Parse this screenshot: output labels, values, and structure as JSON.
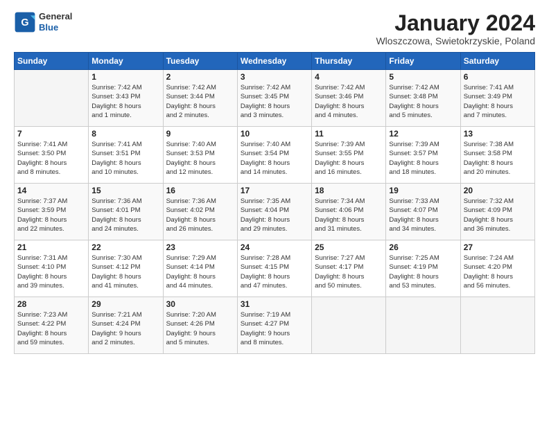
{
  "logo": {
    "line1": "General",
    "line2": "Blue"
  },
  "title": "January 2024",
  "subtitle": "Wloszczowa, Swietokrzyskie, Poland",
  "days_of_week": [
    "Sunday",
    "Monday",
    "Tuesday",
    "Wednesday",
    "Thursday",
    "Friday",
    "Saturday"
  ],
  "weeks": [
    [
      {
        "day": "",
        "info": ""
      },
      {
        "day": "1",
        "info": "Sunrise: 7:42 AM\nSunset: 3:43 PM\nDaylight: 8 hours\nand 1 minute."
      },
      {
        "day": "2",
        "info": "Sunrise: 7:42 AM\nSunset: 3:44 PM\nDaylight: 8 hours\nand 2 minutes."
      },
      {
        "day": "3",
        "info": "Sunrise: 7:42 AM\nSunset: 3:45 PM\nDaylight: 8 hours\nand 3 minutes."
      },
      {
        "day": "4",
        "info": "Sunrise: 7:42 AM\nSunset: 3:46 PM\nDaylight: 8 hours\nand 4 minutes."
      },
      {
        "day": "5",
        "info": "Sunrise: 7:42 AM\nSunset: 3:48 PM\nDaylight: 8 hours\nand 5 minutes."
      },
      {
        "day": "6",
        "info": "Sunrise: 7:41 AM\nSunset: 3:49 PM\nDaylight: 8 hours\nand 7 minutes."
      }
    ],
    [
      {
        "day": "7",
        "info": "Sunrise: 7:41 AM\nSunset: 3:50 PM\nDaylight: 8 hours\nand 8 minutes."
      },
      {
        "day": "8",
        "info": "Sunrise: 7:41 AM\nSunset: 3:51 PM\nDaylight: 8 hours\nand 10 minutes."
      },
      {
        "day": "9",
        "info": "Sunrise: 7:40 AM\nSunset: 3:53 PM\nDaylight: 8 hours\nand 12 minutes."
      },
      {
        "day": "10",
        "info": "Sunrise: 7:40 AM\nSunset: 3:54 PM\nDaylight: 8 hours\nand 14 minutes."
      },
      {
        "day": "11",
        "info": "Sunrise: 7:39 AM\nSunset: 3:55 PM\nDaylight: 8 hours\nand 16 minutes."
      },
      {
        "day": "12",
        "info": "Sunrise: 7:39 AM\nSunset: 3:57 PM\nDaylight: 8 hours\nand 18 minutes."
      },
      {
        "day": "13",
        "info": "Sunrise: 7:38 AM\nSunset: 3:58 PM\nDaylight: 8 hours\nand 20 minutes."
      }
    ],
    [
      {
        "day": "14",
        "info": "Sunrise: 7:37 AM\nSunset: 3:59 PM\nDaylight: 8 hours\nand 22 minutes."
      },
      {
        "day": "15",
        "info": "Sunrise: 7:36 AM\nSunset: 4:01 PM\nDaylight: 8 hours\nand 24 minutes."
      },
      {
        "day": "16",
        "info": "Sunrise: 7:36 AM\nSunset: 4:02 PM\nDaylight: 8 hours\nand 26 minutes."
      },
      {
        "day": "17",
        "info": "Sunrise: 7:35 AM\nSunset: 4:04 PM\nDaylight: 8 hours\nand 29 minutes."
      },
      {
        "day": "18",
        "info": "Sunrise: 7:34 AM\nSunset: 4:06 PM\nDaylight: 8 hours\nand 31 minutes."
      },
      {
        "day": "19",
        "info": "Sunrise: 7:33 AM\nSunset: 4:07 PM\nDaylight: 8 hours\nand 34 minutes."
      },
      {
        "day": "20",
        "info": "Sunrise: 7:32 AM\nSunset: 4:09 PM\nDaylight: 8 hours\nand 36 minutes."
      }
    ],
    [
      {
        "day": "21",
        "info": "Sunrise: 7:31 AM\nSunset: 4:10 PM\nDaylight: 8 hours\nand 39 minutes."
      },
      {
        "day": "22",
        "info": "Sunrise: 7:30 AM\nSunset: 4:12 PM\nDaylight: 8 hours\nand 41 minutes."
      },
      {
        "day": "23",
        "info": "Sunrise: 7:29 AM\nSunset: 4:14 PM\nDaylight: 8 hours\nand 44 minutes."
      },
      {
        "day": "24",
        "info": "Sunrise: 7:28 AM\nSunset: 4:15 PM\nDaylight: 8 hours\nand 47 minutes."
      },
      {
        "day": "25",
        "info": "Sunrise: 7:27 AM\nSunset: 4:17 PM\nDaylight: 8 hours\nand 50 minutes."
      },
      {
        "day": "26",
        "info": "Sunrise: 7:25 AM\nSunset: 4:19 PM\nDaylight: 8 hours\nand 53 minutes."
      },
      {
        "day": "27",
        "info": "Sunrise: 7:24 AM\nSunset: 4:20 PM\nDaylight: 8 hours\nand 56 minutes."
      }
    ],
    [
      {
        "day": "28",
        "info": "Sunrise: 7:23 AM\nSunset: 4:22 PM\nDaylight: 8 hours\nand 59 minutes."
      },
      {
        "day": "29",
        "info": "Sunrise: 7:21 AM\nSunset: 4:24 PM\nDaylight: 9 hours\nand 2 minutes."
      },
      {
        "day": "30",
        "info": "Sunrise: 7:20 AM\nSunset: 4:26 PM\nDaylight: 9 hours\nand 5 minutes."
      },
      {
        "day": "31",
        "info": "Sunrise: 7:19 AM\nSunset: 4:27 PM\nDaylight: 9 hours\nand 8 minutes."
      },
      {
        "day": "",
        "info": ""
      },
      {
        "day": "",
        "info": ""
      },
      {
        "day": "",
        "info": ""
      }
    ]
  ]
}
